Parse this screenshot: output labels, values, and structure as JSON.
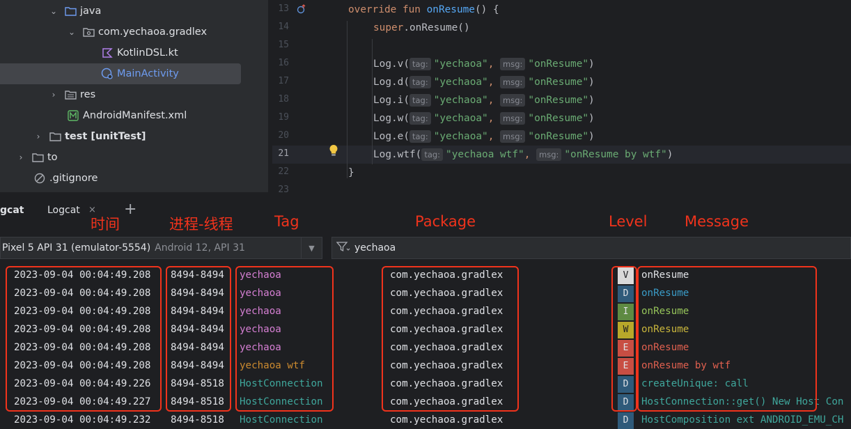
{
  "tree": {
    "items": [
      {
        "label": "java",
        "icon": "folder-icon",
        "chev": "⌄",
        "depth": 0
      },
      {
        "label": "com.yechaoa.gradlex",
        "icon": "package-icon",
        "chev": "⌄",
        "depth": 1
      },
      {
        "label": "KotlinDSL.kt",
        "icon": "kotlin-file-icon",
        "chev": "",
        "depth": 2
      },
      {
        "label": "MainActivity",
        "icon": "activity-class-icon",
        "chev": "",
        "depth": 2
      },
      {
        "label": "res",
        "icon": "res-folder-icon",
        "chev": "›",
        "depth": 1
      },
      {
        "label": "AndroidManifest.xml",
        "icon": "manifest-icon",
        "chev": "",
        "depth": 1
      },
      {
        "label": "test [unitTest]",
        "icon": "test-folder-icon",
        "chev": "›",
        "depth": -1
      },
      {
        "label": "to",
        "icon": "folder-icon",
        "chev": "›",
        "depth": -2
      },
      {
        "label": ".gitignore",
        "icon": "gitignore-icon",
        "chev": "",
        "depth": -2
      }
    ]
  },
  "editor": {
    "lines": [
      13,
      14,
      15,
      16,
      17,
      18,
      19,
      20,
      21,
      22,
      23
    ],
    "active_line": 21,
    "code": {
      "l13_kw": "override fun ",
      "l13_fn": "onResume",
      "l13_rest": "() {",
      "l14_kw": "super",
      "l14_rest": ".onResume()",
      "tag_hint": "tag:",
      "msg_hint": "msg:",
      "tag_val": "\"yechaoa\"",
      "msg_val": "\"onResume\"",
      "calls": [
        "Log.v(",
        "Log.d(",
        "Log.i(",
        "Log.w(",
        "Log.e("
      ],
      "wtf_call": "Log.wtf(",
      "wtf_tag": "\"yechaoa wtf\"",
      "wtf_msg": "\"onResume by wtf\"",
      "comma": ", ",
      "close": ")",
      "brace": "}"
    }
  },
  "logcat": {
    "tabs": [
      {
        "label": "gcat"
      },
      {
        "label": "Logcat"
      }
    ],
    "close_glyph": "×",
    "add_glyph": "+",
    "device": "Pixel 5 API 31 (emulator-5554)",
    "device_version": "Android 12, API 31",
    "filter": "yechaoa",
    "rows": [
      {
        "time": "2023-09-04 00:04:49.208",
        "pid": "8494-8494",
        "tag": "yechaoa",
        "pkg": "com.yechaoa.gradlex",
        "level": "V",
        "msg": "onResume"
      },
      {
        "time": "2023-09-04 00:04:49.208",
        "pid": "8494-8494",
        "tag": "yechaoa",
        "pkg": "com.yechaoa.gradlex",
        "level": "D",
        "msg": "onResume"
      },
      {
        "time": "2023-09-04 00:04:49.208",
        "pid": "8494-8494",
        "tag": "yechaoa",
        "pkg": "com.yechaoa.gradlex",
        "level": "I",
        "msg": "onResume"
      },
      {
        "time": "2023-09-04 00:04:49.208",
        "pid": "8494-8494",
        "tag": "yechaoa",
        "pkg": "com.yechaoa.gradlex",
        "level": "W",
        "msg": "onResume"
      },
      {
        "time": "2023-09-04 00:04:49.208",
        "pid": "8494-8494",
        "tag": "yechaoa",
        "pkg": "com.yechaoa.gradlex",
        "level": "E",
        "msg": "onResume"
      },
      {
        "time": "2023-09-04 00:04:49.208",
        "pid": "8494-8494",
        "tag": "yechaoa wtf",
        "pkg": "com.yechaoa.gradlex",
        "level": "E",
        "msg": "onResume by wtf"
      },
      {
        "time": "2023-09-04 00:04:49.226",
        "pid": "8494-8518",
        "tag": "HostConnection",
        "pkg": "com.yechaoa.gradlex",
        "level": "D",
        "msg": "createUnique: call"
      },
      {
        "time": "2023-09-04 00:04:49.227",
        "pid": "8494-8518",
        "tag": "HostConnection",
        "pkg": "com.yechaoa.gradlex",
        "level": "D",
        "msg": "HostConnection::get() New Host Con"
      },
      {
        "time": "2023-09-04 00:04:49.232",
        "pid": "8494-8518",
        "tag": "HostConnection",
        "pkg": "com.yechaoa.gradlex",
        "level": "D",
        "msg": "HostComposition ext ANDROID_EMU_CH"
      }
    ],
    "tag_colors": {
      "yechaoa": "#d57fd3",
      "yechaoa wtf": "#cb8a2f",
      "HostConnection": "#3fa79c"
    },
    "level_colors": {
      "V": {
        "bg": "#d9d9d9",
        "fg": "#1e1f22",
        "msg": "#dfe1e5"
      },
      "D": {
        "bg": "#2f5a7a",
        "fg": "#dfe1e5",
        "msg": "#3a9bc7"
      },
      "I": {
        "bg": "#5e8a42",
        "fg": "#dfe1e5",
        "msg": "#96c45a"
      },
      "W": {
        "bg": "#b8a82a",
        "fg": "#1e1f22",
        "msg": "#c9b63c"
      },
      "E": {
        "bg": "#c84e43",
        "fg": "#dfe1e5",
        "msg": "#e0604f"
      },
      "D-host": {
        "bg": "#2f5a7a",
        "fg": "#dfe1e5",
        "msg": "#3fa79c"
      }
    }
  },
  "annotations": {
    "time": "时间",
    "process_thread": "进程-线程",
    "tag": "Tag",
    "package": "Package",
    "level": "Level",
    "message": "Message",
    "color": "#f0331c"
  }
}
